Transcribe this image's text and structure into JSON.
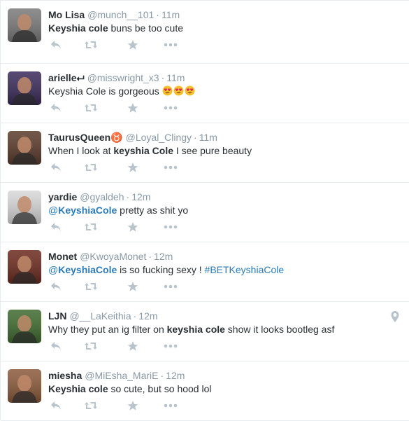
{
  "colors": {
    "name": "#292f33",
    "meta": "#8899a6",
    "link": "#2b7bb9",
    "icon": "#b8c4cc",
    "divider": "#e6ecf0"
  },
  "tweets": [
    {
      "fullname": "Mo Lisa",
      "username": "@munch__101",
      "sep": "·",
      "time": "11m",
      "text": [
        {
          "t": "Keyshia cole",
          "style": "bold"
        },
        {
          "t": " buns be too cute",
          "style": "plain"
        }
      ],
      "avatar_color": "#7a7a7a"
    },
    {
      "fullname": "arielle⮠",
      "username": "@misswright_x3",
      "sep": "·",
      "time": "11m",
      "text": [
        {
          "t": "Keyshia Cole is gorgeous ",
          "style": "plain"
        }
      ],
      "emoji_count": 3,
      "emoji_icon": "heart-eyes-emoji-icon",
      "avatar_color": "#3a2a5a"
    },
    {
      "fullname": "TaurusQueen♉",
      "username": "@Loyal_Clingy",
      "sep": "·",
      "time": "11m",
      "text": [
        {
          "t": "When I look at ",
          "style": "plain"
        },
        {
          "t": "keyshia Cole",
          "style": "bold"
        },
        {
          "t": " I see pure beauty",
          "style": "plain"
        }
      ],
      "avatar_color": "#5a3a2a"
    },
    {
      "fullname": "yardie",
      "username": "@gyaldeh",
      "sep": "·",
      "time": "12m",
      "text": [
        {
          "t": "@",
          "style": "link"
        },
        {
          "t": "KeyshiaCole",
          "style": "linkbold"
        },
        {
          "t": " pretty as shit yo",
          "style": "plain"
        }
      ],
      "avatar_color": "#d8d8d8"
    },
    {
      "fullname": "Monet",
      "username": "@KwoyaMonet",
      "sep": "·",
      "time": "12m",
      "text": [
        {
          "t": "@",
          "style": "link"
        },
        {
          "t": "KeyshiaCole",
          "style": "linkbold"
        },
        {
          "t": " is so fucking sexy ! ",
          "style": "plain"
        },
        {
          "t": "#BETKeyshiaCole",
          "style": "link"
        }
      ],
      "avatar_color": "#6b2a1e"
    },
    {
      "fullname": "LJN",
      "username": "@__LaKeithia",
      "sep": "·",
      "time": "12m",
      "text": [
        {
          "t": "Why they put an ig filter on ",
          "style": "plain"
        },
        {
          "t": "keyshia cole",
          "style": "bold"
        },
        {
          "t": " show it looks bootleg asf",
          "style": "plain"
        }
      ],
      "has_location": true,
      "location_icon": "location-pin-icon",
      "avatar_color": "#3f6a2e"
    },
    {
      "fullname": "miesha",
      "username": "@MiEsha_MariE",
      "sep": "·",
      "time": "12m",
      "text": [
        {
          "t": "Keyshia cole",
          "style": "bold"
        },
        {
          "t": " so cute, but so hood lol",
          "style": "plain"
        }
      ],
      "avatar_color": "#8a5a3a"
    }
  ],
  "action_icons": [
    "reply-icon",
    "retweet-icon",
    "favorite-star-icon",
    "more-dots-icon"
  ]
}
